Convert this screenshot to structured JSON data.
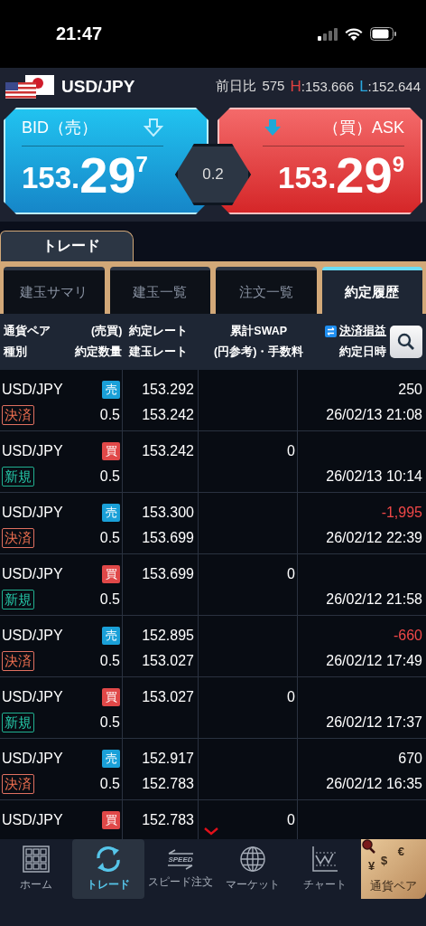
{
  "status_bar": {
    "time": "21:47"
  },
  "header": {
    "pair": "USD/JPY",
    "change_label": "前日比",
    "change": "575",
    "high_label": "H",
    "high": ":153.666",
    "low_label": "L",
    "low": ":152.644"
  },
  "bid": {
    "label": "BID（売）",
    "price_head": "153.",
    "price_big": "29",
    "price_tail": "7"
  },
  "spread": "0.2",
  "ask": {
    "label": "（買）ASK",
    "price_head": "153.",
    "price_big": "29",
    "price_tail": "9"
  },
  "section_tab": "トレード",
  "tabs": [
    {
      "label": "建玉サマリ",
      "selected": false
    },
    {
      "label": "建玉一覧",
      "selected": false
    },
    {
      "label": "注文一覧",
      "selected": false
    },
    {
      "label": "約定履歴",
      "selected": true
    }
  ],
  "columns": {
    "pair": "通貨ペア",
    "type": "種別",
    "side": "(売買)",
    "qty": "約定数量",
    "rate": "約定レート",
    "open_rate": "建玉レート",
    "swap": "累計SWAP",
    "swap_note": "(円参考)・手数料",
    "pnl": "決済損益",
    "datetime": "約定日時"
  },
  "rows": [
    {
      "pair": "USD/JPY",
      "sell": true,
      "side_label": "売",
      "closing": true,
      "tag_label": "決済",
      "qty": "0.5",
      "rate": "153.292",
      "open_rate": "153.242",
      "pnl": "250",
      "loss": false,
      "datetime": "26/02/13 21:08"
    },
    {
      "pair": "USD/JPY",
      "sell": false,
      "side_label": "買",
      "closing": false,
      "tag_label": "新規",
      "qty": "0.5",
      "rate": "153.242",
      "swap": "0",
      "datetime": "26/02/13 10:14"
    },
    {
      "pair": "USD/JPY",
      "sell": true,
      "side_label": "売",
      "closing": true,
      "tag_label": "決済",
      "qty": "0.5",
      "rate": "153.300",
      "open_rate": "153.699",
      "pnl": "-1,995",
      "loss": true,
      "datetime": "26/02/12 22:39"
    },
    {
      "pair": "USD/JPY",
      "sell": false,
      "side_label": "買",
      "closing": false,
      "tag_label": "新規",
      "qty": "0.5",
      "rate": "153.699",
      "swap": "0",
      "datetime": "26/02/12 21:58"
    },
    {
      "pair": "USD/JPY",
      "sell": true,
      "side_label": "売",
      "closing": true,
      "tag_label": "決済",
      "qty": "0.5",
      "rate": "152.895",
      "open_rate": "153.027",
      "pnl": "-660",
      "loss": true,
      "datetime": "26/02/12 17:49"
    },
    {
      "pair": "USD/JPY",
      "sell": false,
      "side_label": "買",
      "closing": false,
      "tag_label": "新規",
      "qty": "0.5",
      "rate": "153.027",
      "swap": "0",
      "datetime": "26/02/12 17:37"
    },
    {
      "pair": "USD/JPY",
      "sell": true,
      "side_label": "売",
      "closing": true,
      "tag_label": "決済",
      "qty": "0.5",
      "rate": "152.917",
      "open_rate": "152.783",
      "pnl": "670",
      "loss": false,
      "datetime": "26/02/12 16:35"
    },
    {
      "pair": "USD/JPY",
      "sell": false,
      "side_label": "買",
      "rate": "152.783",
      "swap": "0"
    }
  ],
  "nav": [
    {
      "kind": "home",
      "label": "ホーム",
      "selected": false
    },
    {
      "kind": "trade",
      "label": "トレード",
      "selected": true
    },
    {
      "kind": "speed",
      "label": "スピード注文",
      "icon_text": "SPEED",
      "selected": false
    },
    {
      "kind": "market",
      "label": "マーケット",
      "selected": false
    },
    {
      "kind": "chart",
      "label": "チャート",
      "selected": false
    },
    {
      "kind": "pair",
      "label": "通貨ペア",
      "symbols": [
        "€",
        "¥",
        "$"
      ]
    }
  ]
}
